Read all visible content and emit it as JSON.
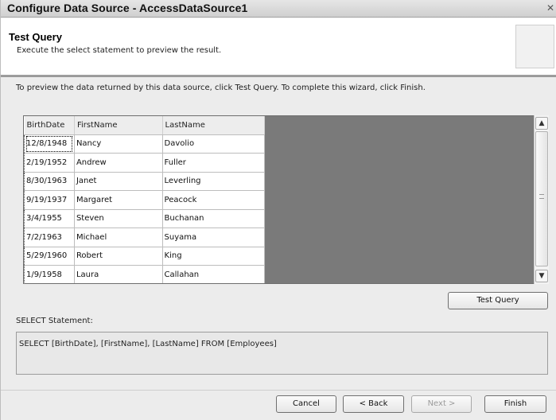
{
  "window": {
    "title": "Configure Data Source - AccessDataSource1",
    "close_icon": "close-icon"
  },
  "header": {
    "title": "Test Query",
    "subtitle": "Execute the select statement to preview the result."
  },
  "intro_text": "To preview the data returned by this data source, click Test Query. To complete this wizard, click Finish.",
  "grid": {
    "columns": [
      "BirthDate",
      "FirstName",
      "LastName"
    ],
    "rows": [
      [
        "12/8/1948",
        "Nancy",
        "Davolio"
      ],
      [
        "2/19/1952",
        "Andrew",
        "Fuller"
      ],
      [
        "8/30/1963",
        "Janet",
        "Leverling"
      ],
      [
        "9/19/1937",
        "Margaret",
        "Peacock"
      ],
      [
        "3/4/1955",
        "Steven",
        "Buchanan"
      ],
      [
        "7/2/1963",
        "Michael",
        "Suyama"
      ],
      [
        "5/29/1960",
        "Robert",
        "King"
      ],
      [
        "1/9/1958",
        "Laura",
        "Callahan"
      ]
    ]
  },
  "buttons": {
    "test_query": "Test Query",
    "cancel": "Cancel",
    "back": "< Back",
    "next": "Next >",
    "finish": "Finish"
  },
  "select_statement": {
    "label": "SELECT Statement:",
    "value": "SELECT [BirthDate], [FirstName], [LastName] FROM [Employees]"
  }
}
